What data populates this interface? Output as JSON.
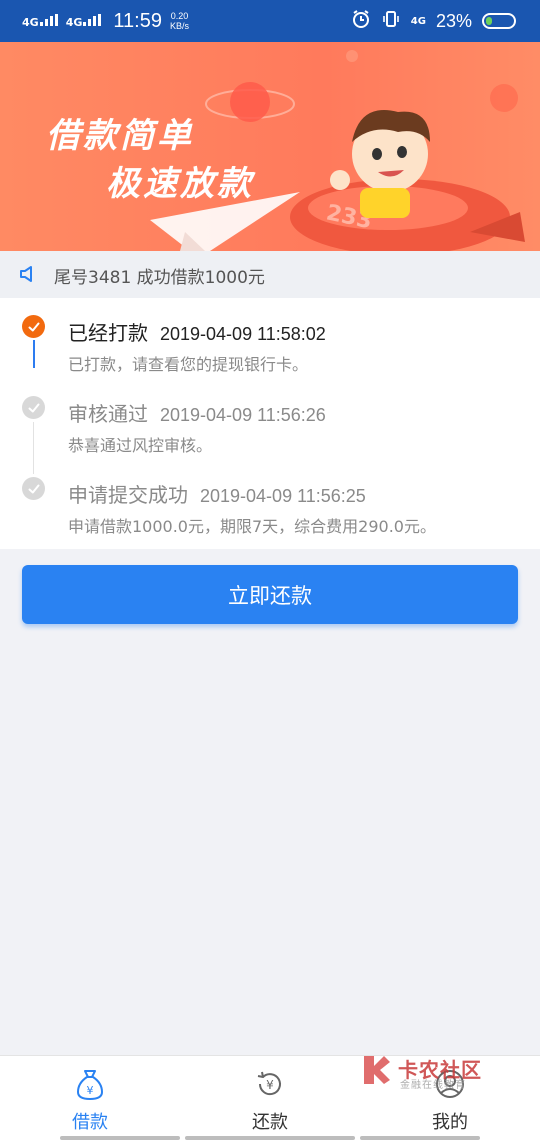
{
  "status_bar": {
    "net1": "4G",
    "net2": "4G",
    "time": "11:59",
    "speed_value": "0.20",
    "speed_unit": "KB/s",
    "net3": "4G",
    "battery_percent": "23%",
    "battery_level": 0.23,
    "icons": [
      "signal-icon",
      "alarm-icon",
      "vibrate-icon",
      "battery-icon"
    ]
  },
  "banner": {
    "line1": "借款简单",
    "line2": "极速放款",
    "rocket_number": "233"
  },
  "notice": {
    "text": "尾号3481 成功借款1000元",
    "icon": "speaker-icon"
  },
  "timeline": [
    {
      "title": "已经打款",
      "time": "2019-04-09 11:58:02",
      "desc": "已打款，请查看您的提现银行卡。",
      "status": "active"
    },
    {
      "title": "审核通过",
      "time": "2019-04-09 11:56:26",
      "desc": "恭喜通过风控审核。",
      "status": "done"
    },
    {
      "title": "申请提交成功",
      "time": "2019-04-09 11:56:25",
      "desc": "申请借款1000.0元，期限7天，综合费用290.0元。",
      "status": "done"
    }
  ],
  "repay_button": "立即还款",
  "nav": [
    {
      "label": "借款",
      "icon": "money-bag-icon",
      "active": true
    },
    {
      "label": "还款",
      "icon": "repay-icon",
      "active": false
    },
    {
      "label": "我的",
      "icon": "profile-icon",
      "active": false
    }
  ],
  "watermark": {
    "title": "卡农社区",
    "subtitle": "金融在线教育"
  },
  "colors": {
    "status_bar": "#1a56b0",
    "accent": "#2a82f2",
    "active_dot": "#f26a0f",
    "banner": "#ff7a5c"
  }
}
